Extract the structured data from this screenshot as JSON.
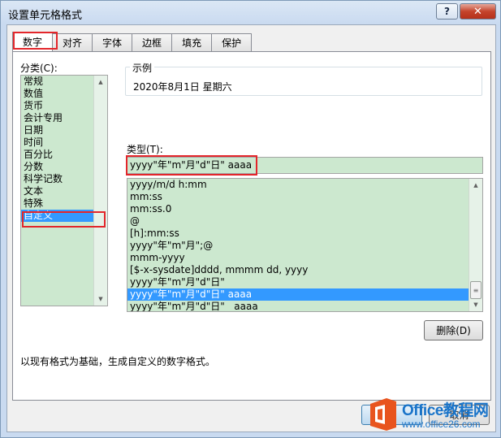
{
  "window": {
    "title": "设置单元格格式",
    "help_label": "?",
    "close_label": "✕"
  },
  "tabs": [
    {
      "label": "数字",
      "active": true
    },
    {
      "label": "对齐",
      "active": false
    },
    {
      "label": "字体",
      "active": false
    },
    {
      "label": "边框",
      "active": false
    },
    {
      "label": "填充",
      "active": false
    },
    {
      "label": "保护",
      "active": false
    }
  ],
  "category": {
    "label": "分类(C):",
    "items": [
      "常规",
      "数值",
      "货币",
      "会计专用",
      "日期",
      "时间",
      "百分比",
      "分数",
      "科学记数",
      "文本",
      "特殊",
      "自定义"
    ],
    "selected": "自定义"
  },
  "sample": {
    "label": "示例",
    "value": "2020年8月1日 星期六"
  },
  "type": {
    "label": "类型(T):",
    "value": "yyyy\"年\"m\"月\"d\"日\" aaaa",
    "items": [
      "yyyy/m/d h:mm",
      "mm:ss",
      "mm:ss.0",
      "@",
      "[h]:mm:ss",
      "yyyy\"年\"m\"月\";@",
      "mmm-yyyy",
      "[$-x-sysdate]dddd, mmmm dd, yyyy",
      "yyyy\"年\"m\"月\"d\"日\"",
      "yyyy\"年\"m\"月\"d\"日\" aaaa",
      "yyyy\"年\"m\"月\"d\"日\"   aaaa"
    ],
    "selected_index": 9
  },
  "delete_label": "删除(D)",
  "description": "以现有格式为基础，生成自定义的数字格式。",
  "cancel_label": "取消",
  "watermark": {
    "brand": "Office教程网",
    "url": "www.office26.com"
  },
  "colors": {
    "list_bg": "#cce8cf",
    "selection": "#3399ff",
    "highlight_box": "#e3262b",
    "watermark": "#1a74c9",
    "logo_orange": "#e8541e"
  }
}
